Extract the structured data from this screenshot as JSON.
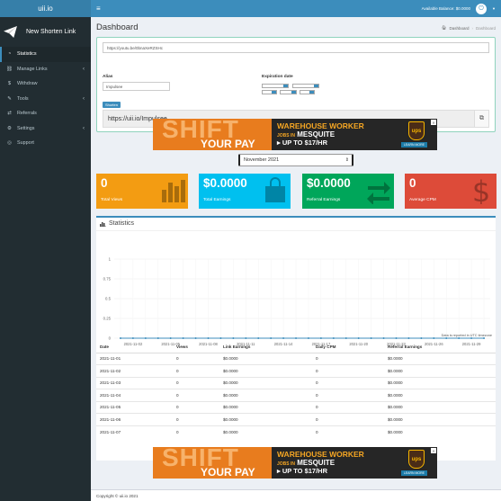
{
  "app": {
    "logo": "uii.io"
  },
  "topbar": {
    "balance": "Available Balance: $0.0000"
  },
  "sidebar": {
    "new_link": "New Shorten Link",
    "items": [
      {
        "label": "Statistics",
        "icon": "dashboard-icon",
        "active": true
      },
      {
        "label": "Manage Links",
        "icon": "link-icon",
        "chev": "‹"
      },
      {
        "label": "Withdraw",
        "icon": "dollar-icon"
      },
      {
        "label": "Tools",
        "icon": "wrench-icon",
        "chev": "‹"
      },
      {
        "label": "Referrals",
        "icon": "exchange-icon"
      },
      {
        "label": "Settings",
        "icon": "gears-icon",
        "chev": "‹"
      },
      {
        "label": "Support",
        "icon": "life-ring-icon"
      }
    ]
  },
  "page": {
    "title": "Dashboard",
    "breadcrumb": [
      "Dashboard",
      "Dashboard"
    ]
  },
  "shorten": {
    "url": "https://youtu.be/0bnaXeRZSHc",
    "alias_label": "Alias",
    "alias_value": "Impulsee",
    "expiration_label": "Expiration date",
    "button": "Shorten",
    "result": "https://uii.io/Impulsee"
  },
  "ad": {
    "shift": "SHIFT",
    "your_pay": "YOUR PAY",
    "headline": "WAREHOUSE WORKER",
    "jobs_in": "JOBS IN",
    "city": "MESQUITE",
    "pay": "▸ UP TO $17/HR",
    "brand": "ups",
    "cta": "LEARN MORE"
  },
  "month_select": {
    "value": "November 2021"
  },
  "tiles": [
    {
      "value": "0",
      "label": "Total Views",
      "color": "#f39c12",
      "icon": "bar-chart-icon"
    },
    {
      "value": "$0.0000",
      "label": "Total Earnings",
      "color": "#00c0ef",
      "icon": "shopping-bag-icon"
    },
    {
      "value": "$0.0000",
      "label": "Referral Earnings",
      "color": "#00a65a",
      "icon": "exchange-icon"
    },
    {
      "value": "0",
      "label": "Average CPM",
      "color": "#dd4b39",
      "icon": "dollar-icon"
    }
  ],
  "statistics": {
    "title": "Statistics",
    "note": "Data is reported in UTC timezone",
    "columns": [
      "Date",
      "Views",
      "Link Earnings",
      "Daily CPM",
      "Referral Earnings"
    ],
    "rows": [
      [
        "2021-11-01",
        "0",
        "$0.0000",
        "0",
        "$0.0000"
      ],
      [
        "2021-11-02",
        "0",
        "$0.0000",
        "0",
        "$0.0000"
      ],
      [
        "2021-11-03",
        "0",
        "$0.0000",
        "0",
        "$0.0000"
      ],
      [
        "2021-11-04",
        "0",
        "$0.0000",
        "0",
        "$0.0000"
      ],
      [
        "2021-11-05",
        "0",
        "$0.0000",
        "0",
        "$0.0000"
      ],
      [
        "2021-11-06",
        "0",
        "$0.0000",
        "0",
        "$0.0000"
      ],
      [
        "2021-11-07",
        "0",
        "$0.0000",
        "0",
        "$0.0000"
      ]
    ]
  },
  "chart_data": {
    "type": "line",
    "title": "",
    "xlabel": "",
    "ylabel": "",
    "ylim": [
      0,
      1
    ],
    "yticks": [
      "1",
      "0.75",
      "0.5",
      "0.25",
      "0"
    ],
    "xtick_labels": [
      "2021-11-02",
      "2021-11-05",
      "2021-11-08",
      "2021-11-11",
      "2021-11-14",
      "2021-11-17",
      "2021-11-20",
      "2021-11-23",
      "2021-11-26",
      "2021-11-29"
    ],
    "x": [
      "2021-11-01",
      "2021-11-02",
      "2021-11-03",
      "2021-11-04",
      "2021-11-05",
      "2021-11-06",
      "2021-11-07",
      "2021-11-08",
      "2021-11-09",
      "2021-11-10",
      "2021-11-11",
      "2021-11-12",
      "2021-11-13",
      "2021-11-14",
      "2021-11-15",
      "2021-11-16",
      "2021-11-17",
      "2021-11-18",
      "2021-11-19",
      "2021-11-20",
      "2021-11-21",
      "2021-11-22",
      "2021-11-23",
      "2021-11-24",
      "2021-11-25",
      "2021-11-26",
      "2021-11-27",
      "2021-11-28",
      "2021-11-29",
      "2021-11-30"
    ],
    "series": [
      {
        "values": [
          0,
          0,
          0,
          0,
          0,
          0,
          0,
          0,
          0,
          0,
          0,
          0,
          0,
          0,
          0,
          0,
          0,
          0,
          0,
          0,
          0,
          0,
          0,
          0,
          0,
          0,
          0,
          0,
          0,
          0
        ]
      }
    ],
    "grid": true,
    "line_color": "#3c8dbc"
  },
  "footer": {
    "text": "Copyright © uii.io 2021"
  }
}
